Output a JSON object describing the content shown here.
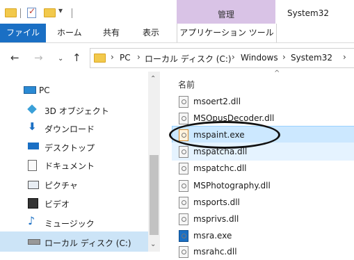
{
  "window": {
    "title": "System32",
    "context_tab": "管理",
    "quick_access_dropdown": "▾"
  },
  "ribbon": {
    "file_tab": "ファイル",
    "tabs": [
      "ホーム",
      "共有",
      "表示"
    ],
    "app_tools": "アプリケーション ツール"
  },
  "address": {
    "crumbs": [
      "PC",
      "ローカル ディスク (C:)",
      "Windows",
      "System32"
    ]
  },
  "nav": {
    "items": [
      {
        "label": "PC",
        "icon": "pc-icon"
      },
      {
        "label": "3D オブジェクト",
        "icon": "3d-objects-icon"
      },
      {
        "label": "ダウンロード",
        "icon": "download-icon"
      },
      {
        "label": "デスクトップ",
        "icon": "desktop-icon"
      },
      {
        "label": "ドキュメント",
        "icon": "document-icon"
      },
      {
        "label": "ピクチャ",
        "icon": "pictures-icon"
      },
      {
        "label": "ビデオ",
        "icon": "video-icon"
      },
      {
        "label": "ミュージック",
        "icon": "music-icon"
      },
      {
        "label": "ローカル ディスク (C:)",
        "icon": "disk-icon"
      }
    ]
  },
  "files": {
    "column_name": "名前",
    "items": [
      "msoert2.dll",
      "MSOpusDecoder.dll",
      "mspaint.exe",
      "mspatcha.dll",
      "mspatchc.dll",
      "MSPhotography.dll",
      "msports.dll",
      "msprivs.dll",
      "msra.exe",
      "msrahc.dll"
    ],
    "selected_index": 2
  },
  "colors": {
    "accent": "#1a6fc4",
    "context_tab": "#d9c3e6",
    "selection": "#cce8ff",
    "folder": "#f2c94c"
  }
}
